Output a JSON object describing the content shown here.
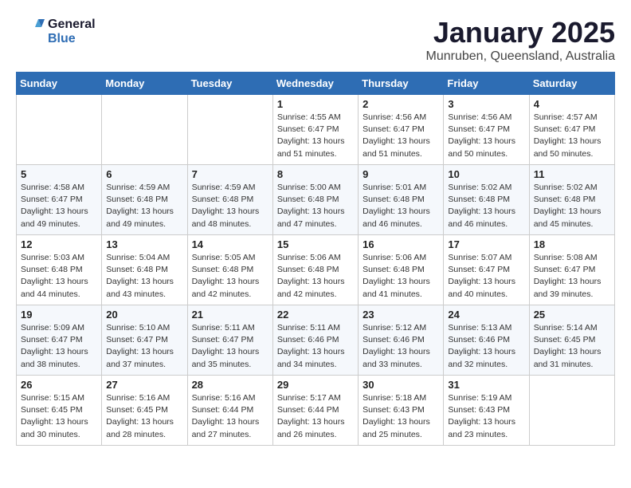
{
  "header": {
    "logo_line1": "General",
    "logo_line2": "Blue",
    "month": "January 2025",
    "location": "Munruben, Queensland, Australia"
  },
  "days_of_week": [
    "Sunday",
    "Monday",
    "Tuesday",
    "Wednesday",
    "Thursday",
    "Friday",
    "Saturday"
  ],
  "weeks": [
    [
      {
        "num": "",
        "info": ""
      },
      {
        "num": "",
        "info": ""
      },
      {
        "num": "",
        "info": ""
      },
      {
        "num": "1",
        "info": "Sunrise: 4:55 AM\nSunset: 6:47 PM\nDaylight: 13 hours\nand 51 minutes."
      },
      {
        "num": "2",
        "info": "Sunrise: 4:56 AM\nSunset: 6:47 PM\nDaylight: 13 hours\nand 51 minutes."
      },
      {
        "num": "3",
        "info": "Sunrise: 4:56 AM\nSunset: 6:47 PM\nDaylight: 13 hours\nand 50 minutes."
      },
      {
        "num": "4",
        "info": "Sunrise: 4:57 AM\nSunset: 6:47 PM\nDaylight: 13 hours\nand 50 minutes."
      }
    ],
    [
      {
        "num": "5",
        "info": "Sunrise: 4:58 AM\nSunset: 6:47 PM\nDaylight: 13 hours\nand 49 minutes."
      },
      {
        "num": "6",
        "info": "Sunrise: 4:59 AM\nSunset: 6:48 PM\nDaylight: 13 hours\nand 49 minutes."
      },
      {
        "num": "7",
        "info": "Sunrise: 4:59 AM\nSunset: 6:48 PM\nDaylight: 13 hours\nand 48 minutes."
      },
      {
        "num": "8",
        "info": "Sunrise: 5:00 AM\nSunset: 6:48 PM\nDaylight: 13 hours\nand 47 minutes."
      },
      {
        "num": "9",
        "info": "Sunrise: 5:01 AM\nSunset: 6:48 PM\nDaylight: 13 hours\nand 46 minutes."
      },
      {
        "num": "10",
        "info": "Sunrise: 5:02 AM\nSunset: 6:48 PM\nDaylight: 13 hours\nand 46 minutes."
      },
      {
        "num": "11",
        "info": "Sunrise: 5:02 AM\nSunset: 6:48 PM\nDaylight: 13 hours\nand 45 minutes."
      }
    ],
    [
      {
        "num": "12",
        "info": "Sunrise: 5:03 AM\nSunset: 6:48 PM\nDaylight: 13 hours\nand 44 minutes."
      },
      {
        "num": "13",
        "info": "Sunrise: 5:04 AM\nSunset: 6:48 PM\nDaylight: 13 hours\nand 43 minutes."
      },
      {
        "num": "14",
        "info": "Sunrise: 5:05 AM\nSunset: 6:48 PM\nDaylight: 13 hours\nand 42 minutes."
      },
      {
        "num": "15",
        "info": "Sunrise: 5:06 AM\nSunset: 6:48 PM\nDaylight: 13 hours\nand 42 minutes."
      },
      {
        "num": "16",
        "info": "Sunrise: 5:06 AM\nSunset: 6:48 PM\nDaylight: 13 hours\nand 41 minutes."
      },
      {
        "num": "17",
        "info": "Sunrise: 5:07 AM\nSunset: 6:47 PM\nDaylight: 13 hours\nand 40 minutes."
      },
      {
        "num": "18",
        "info": "Sunrise: 5:08 AM\nSunset: 6:47 PM\nDaylight: 13 hours\nand 39 minutes."
      }
    ],
    [
      {
        "num": "19",
        "info": "Sunrise: 5:09 AM\nSunset: 6:47 PM\nDaylight: 13 hours\nand 38 minutes."
      },
      {
        "num": "20",
        "info": "Sunrise: 5:10 AM\nSunset: 6:47 PM\nDaylight: 13 hours\nand 37 minutes."
      },
      {
        "num": "21",
        "info": "Sunrise: 5:11 AM\nSunset: 6:47 PM\nDaylight: 13 hours\nand 35 minutes."
      },
      {
        "num": "22",
        "info": "Sunrise: 5:11 AM\nSunset: 6:46 PM\nDaylight: 13 hours\nand 34 minutes."
      },
      {
        "num": "23",
        "info": "Sunrise: 5:12 AM\nSunset: 6:46 PM\nDaylight: 13 hours\nand 33 minutes."
      },
      {
        "num": "24",
        "info": "Sunrise: 5:13 AM\nSunset: 6:46 PM\nDaylight: 13 hours\nand 32 minutes."
      },
      {
        "num": "25",
        "info": "Sunrise: 5:14 AM\nSunset: 6:45 PM\nDaylight: 13 hours\nand 31 minutes."
      }
    ],
    [
      {
        "num": "26",
        "info": "Sunrise: 5:15 AM\nSunset: 6:45 PM\nDaylight: 13 hours\nand 30 minutes."
      },
      {
        "num": "27",
        "info": "Sunrise: 5:16 AM\nSunset: 6:45 PM\nDaylight: 13 hours\nand 28 minutes."
      },
      {
        "num": "28",
        "info": "Sunrise: 5:16 AM\nSunset: 6:44 PM\nDaylight: 13 hours\nand 27 minutes."
      },
      {
        "num": "29",
        "info": "Sunrise: 5:17 AM\nSunset: 6:44 PM\nDaylight: 13 hours\nand 26 minutes."
      },
      {
        "num": "30",
        "info": "Sunrise: 5:18 AM\nSunset: 6:43 PM\nDaylight: 13 hours\nand 25 minutes."
      },
      {
        "num": "31",
        "info": "Sunrise: 5:19 AM\nSunset: 6:43 PM\nDaylight: 13 hours\nand 23 minutes."
      },
      {
        "num": "",
        "info": ""
      }
    ]
  ]
}
